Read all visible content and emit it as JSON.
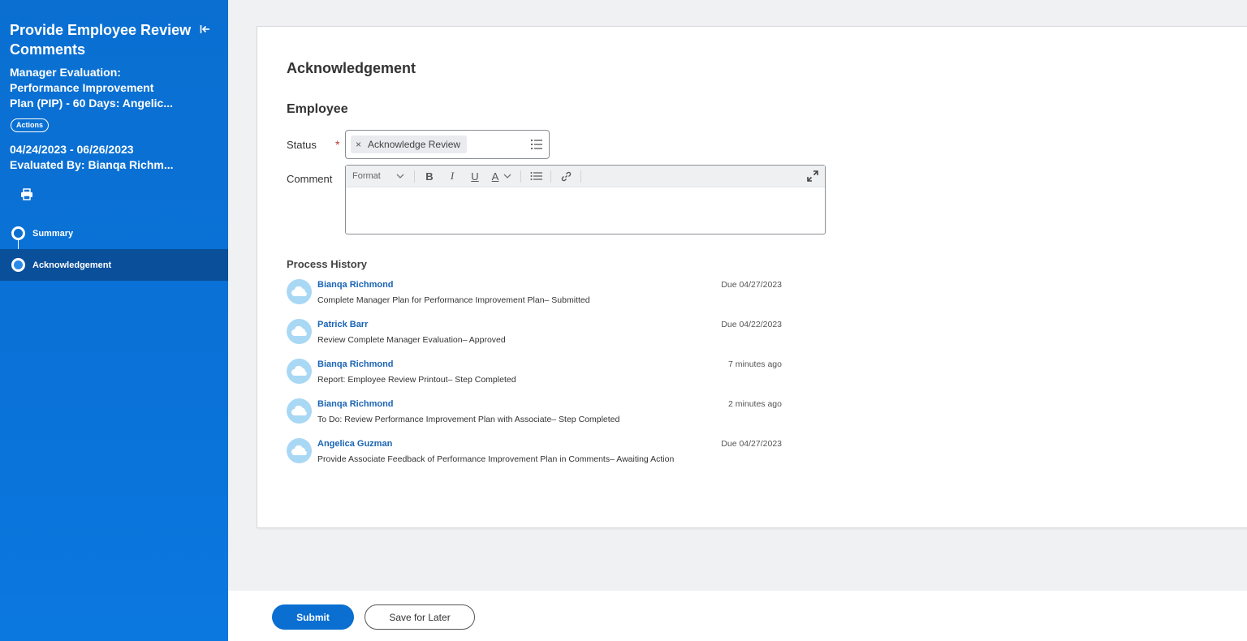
{
  "sidebar": {
    "title": "Provide Employee Review Comments",
    "subtitle": "Manager Evaluation: Performance Improvement Plan (PIP) - 60 Days: Angelic...",
    "actions_label": "Actions",
    "date_range": "04/24/2023 - 06/26/2023",
    "evaluated_by": "Evaluated By: Bianqa Richm...",
    "steps": [
      {
        "label": "Summary",
        "active": false
      },
      {
        "label": "Acknowledgement",
        "active": true
      }
    ],
    "icons": {
      "collapse": "collapse-left-icon",
      "print": "printer-icon"
    }
  },
  "main": {
    "heading": "Acknowledgement",
    "section": "Employee",
    "status_label": "Status",
    "required_mark": "*",
    "status_value": "Acknowledge Review",
    "chip_remove": "×",
    "comment_label": "Comment",
    "toolbar": {
      "format": "Format",
      "bold": "B",
      "italic": "I",
      "underline": "U",
      "color": "A"
    },
    "history_title": "Process History",
    "history": [
      {
        "name": "Bianqa Richmond",
        "desc": "Complete Manager Plan for Performance Improvement Plan– Submitted",
        "time": "Due 04/27/2023"
      },
      {
        "name": "Patrick Barr",
        "desc": "Review Complete Manager Evaluation– Approved",
        "time": "Due 04/22/2023"
      },
      {
        "name": "Bianqa Richmond",
        "desc": "Report: Employee Review Printout– Step Completed",
        "time": "7 minutes ago"
      },
      {
        "name": "Bianqa Richmond",
        "desc": "To Do: Review Performance Improvement Plan with Associate– Step Completed",
        "time": "2 minutes ago"
      },
      {
        "name": "Angelica Guzman",
        "desc": "Provide Associate Feedback of Performance Improvement Plan in Comments– Awaiting Action",
        "time": "Due 04/27/2023"
      }
    ]
  },
  "footer": {
    "submit": "Submit",
    "save_later": "Save for Later"
  },
  "colors": {
    "sidebar_blue": "#0a6fd1",
    "active_step": "#0a4f99",
    "link_blue": "#1a64b4",
    "avatar_bg": "#a9d8f5"
  }
}
